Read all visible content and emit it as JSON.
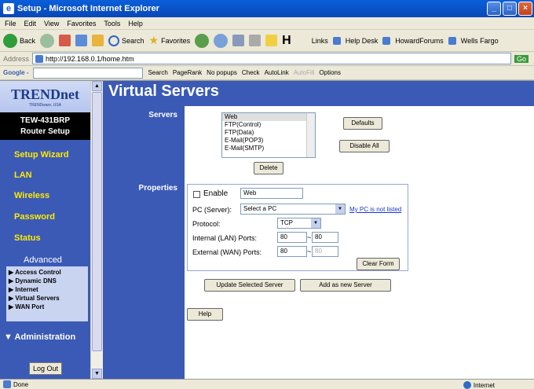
{
  "window": {
    "title": "Setup - Microsoft Internet Explorer"
  },
  "menu": [
    "File",
    "Edit",
    "View",
    "Favorites",
    "Tools",
    "Help"
  ],
  "toolbar": {
    "back": "Back",
    "search": "Search",
    "favorites": "Favorites",
    "links_label": "Links",
    "link1": "Help Desk",
    "link2": "HowardForums",
    "link3": "Wells Fargo"
  },
  "address": {
    "label": "Address",
    "url": "http://192.168.0.1/home.htm",
    "go": "Go"
  },
  "google": {
    "brand": "Google -",
    "search": "Search",
    "pagerank": "PageRank",
    "popups": "No popups",
    "check": "Check",
    "autolink": "AutoLink",
    "autofill": "AutoFill",
    "options": "Options"
  },
  "sidebar": {
    "logo": "TRENDnet",
    "logo_tag": "TRENDware, USA",
    "model": "TEW-431BRP",
    "subtitle": "Router Setup",
    "nav": [
      "Setup Wizard",
      "LAN",
      "Wireless",
      "Password",
      "Status"
    ],
    "advanced_title": "Advanced",
    "advanced_items": [
      "Access Control",
      "Dynamic DNS",
      "Internet",
      "Virtual Servers",
      "WAN Port"
    ],
    "administration": "Administration",
    "logout": "Log Out"
  },
  "main": {
    "title": "Virtual Servers",
    "servers_label": "Servers",
    "servers_list": [
      "Web",
      "FTP(Control)",
      "FTP(Data)",
      "E-Mail(POP3)",
      "E-Mail(SMTP)"
    ],
    "defaults_button": "Defaults",
    "disable_all_button": "Disable All",
    "delete_button": "Delete",
    "properties_label": "Properties",
    "enable_label": "Enable",
    "enable_value": "Web",
    "pc_label": "PC (Server):",
    "pc_select": "Select a PC",
    "pc_link": "My PC is not listed",
    "protocol_label": "Protocol:",
    "protocol_value": "TCP",
    "internal_label": "Internal (LAN) Ports:",
    "internal_from": "80",
    "internal_to": "80",
    "external_label": "External (WAN) Ports:",
    "external_from": "80",
    "external_to": "80",
    "clear_form_button": "Clear Form",
    "update_button": "Update Selected Server",
    "add_button": "Add as new Server",
    "help_button": "Help"
  },
  "status": {
    "left": "Done",
    "right": "Internet"
  }
}
